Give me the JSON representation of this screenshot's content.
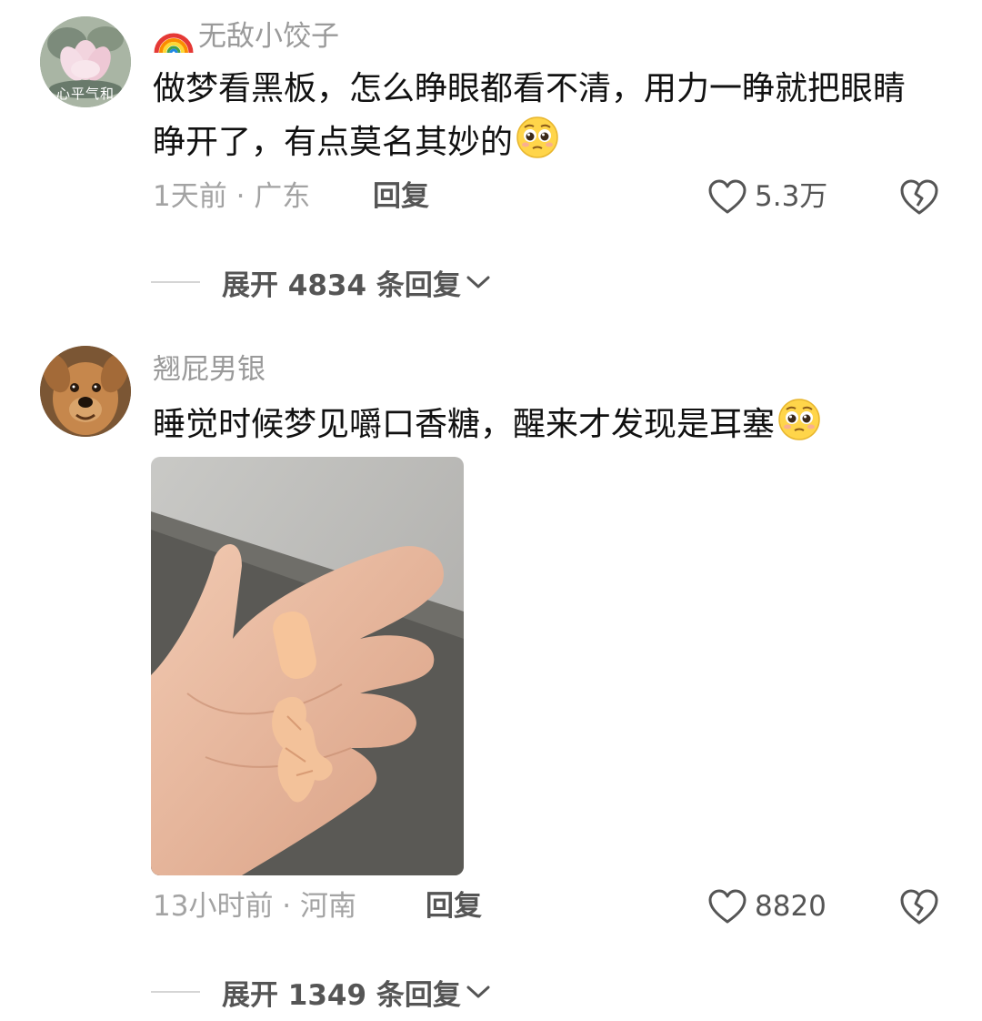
{
  "comments": [
    {
      "username": "无敌小饺子",
      "text": "做梦看黑板，怎么睁眼都看不清，用力一睁就把眼睛睁开了，有点莫名其妙的",
      "time_location": "1天前 · 广东",
      "reply_label": "回复",
      "likes": "5.3万",
      "expand_text": "展开 4834 条回复",
      "avatar_text": "心平气和"
    },
    {
      "username": "翘屁男银",
      "text": "睡觉时候梦见嚼口香糖，醒来才发现是耳塞",
      "time_location": "13小时前 · 河南",
      "reply_label": "回复",
      "likes": "8820",
      "expand_text": "展开 1349 条回复"
    }
  ],
  "colors": {
    "meta_gray": "#a3a3a3",
    "text_black": "#111111",
    "action_gray": "#555555"
  },
  "icons": [
    "rainbow-icon",
    "pleading-face-emoji",
    "heart-icon",
    "broken-heart-icon",
    "chevron-down-icon"
  ]
}
